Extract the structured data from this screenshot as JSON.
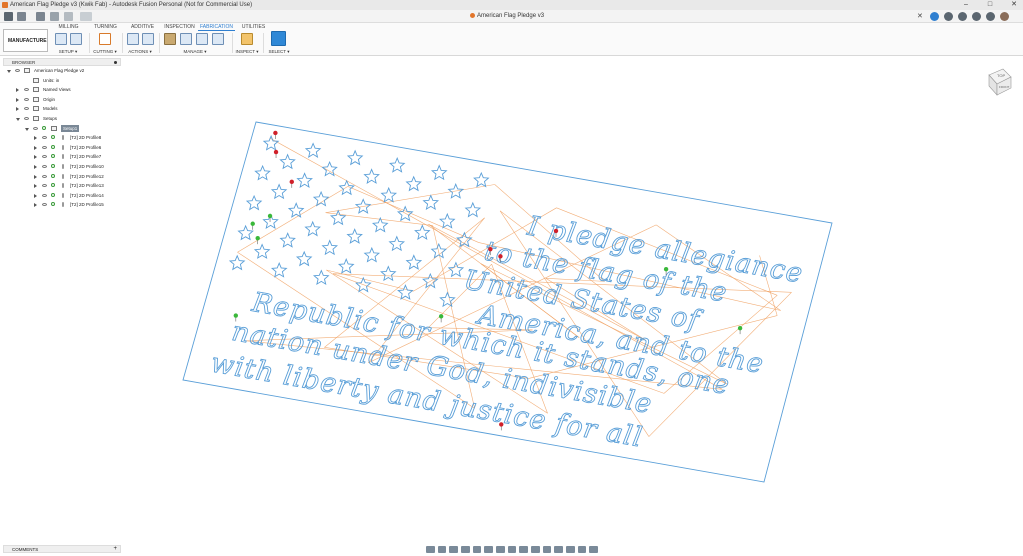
{
  "window": {
    "title": "American Flag Pledge v3 (Kwik Fab) - Autodesk Fusion Personal (Not for Commercial Use)",
    "controls": [
      "–",
      "□",
      "✕"
    ]
  },
  "document_tab": {
    "label": "American Flag Pledge v3",
    "close": "✕"
  },
  "ribbon": {
    "workspace": "MANUFACTURE ▾",
    "tabs": [
      "MILLING",
      "TURNING",
      "ADDITIVE",
      "INSPECTION",
      "FABRICATION",
      "UTILITIES"
    ],
    "active_tab": "FABRICATION",
    "groups": [
      "SETUP ▾",
      "CUTTING ▾",
      "ACTIONS ▾",
      "MANAGE ▾",
      "INSPECT ▾",
      "SELECT ▾"
    ]
  },
  "browser": {
    "header": "BROWSER",
    "rows": [
      {
        "label": "American Flag Pledge v2",
        "indent": 0,
        "tri": "open",
        "icon": "document-icon"
      },
      {
        "label": "Units: in",
        "indent": 1,
        "tri": "",
        "icon": "document-icon"
      },
      {
        "label": "Named Views",
        "indent": 1,
        "tri": "closed",
        "icon": "folder-icon"
      },
      {
        "label": "Origin",
        "indent": 1,
        "tri": "closed",
        "icon": "folder-icon"
      },
      {
        "label": "Models",
        "indent": 1,
        "tri": "closed",
        "icon": "folder-icon"
      },
      {
        "label": "Setups",
        "indent": 1,
        "tri": "open",
        "icon": "folder-icon"
      },
      {
        "label": "Setup1",
        "indent": 2,
        "tri": "open",
        "icon": "setup-icon",
        "highlight": true
      },
      {
        "label": "[T2] 2D Profile8",
        "indent": 3,
        "tri": "closed",
        "icon": "tool-icon"
      },
      {
        "label": "[T2] 2D Profile6",
        "indent": 3,
        "tri": "closed",
        "icon": "tool-icon"
      },
      {
        "label": "[T2] 2D Profile7",
        "indent": 3,
        "tri": "closed",
        "icon": "tool-icon"
      },
      {
        "label": "[T2] 2D Profile10",
        "indent": 3,
        "tri": "closed",
        "icon": "tool-icon"
      },
      {
        "label": "[T2] 2D Profile12",
        "indent": 3,
        "tri": "closed",
        "icon": "tool-icon"
      },
      {
        "label": "[T2] 2D Profile13",
        "indent": 3,
        "tri": "closed",
        "icon": "tool-icon"
      },
      {
        "label": "[T2] 2D Profile14",
        "indent": 3,
        "tri": "closed",
        "icon": "tool-icon"
      },
      {
        "label": "[T2] 2D Profile15",
        "indent": 3,
        "tri": "closed",
        "icon": "tool-icon"
      }
    ]
  },
  "comments": {
    "header": "COMMENTS",
    "add": "+"
  },
  "viewcube": {
    "face": "TOP",
    "side": "FRONT"
  },
  "pledge_lines": [
    "I pledge allegiance",
    "to the flag of the",
    "United States of",
    "America, and to the",
    "Republic for which it stands, one",
    "nation under God, indivisible",
    "with liberty and justice for all"
  ],
  "colors": {
    "profile": "#5a9fd8",
    "toolpath": "#f0a060",
    "accent": "#2f7fd0",
    "marker_red": "#d0202a",
    "marker_green": "#3ab83a"
  }
}
